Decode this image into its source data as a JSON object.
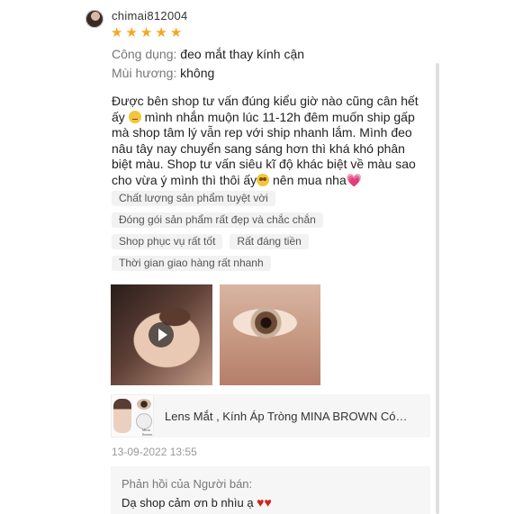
{
  "review": {
    "username": "chimai812004",
    "rating": 5,
    "attributes": [
      {
        "label": "Công dụng",
        "value": "đeo mắt thay kính cận"
      },
      {
        "label": "Mùi hương",
        "value": "không"
      }
    ],
    "text_part1": "Được bên shop tư vấn đúng kiểu giờ nào cũng cân hết ấy ",
    "text_part2": " mình nhắn muộn lúc 11-12h đêm muốn ship gấp mà shop tâm lý vẫn rep với ship nhanh lắm. Mình đeo nâu tây nay chuyển sang sáng hơn thì khá khó phân biệt màu. Shop tư vấn siêu kĩ độ khác biệt về màu sao cho vừa ý mình thì thôi ấy",
    "text_part3": " nên mua nha",
    "tags": [
      [
        "Chất lượng sản phẩm tuyệt vời"
      ],
      [
        "Đóng gói sản phẩm rất đẹp và chắc chắn"
      ],
      [
        "Shop phục vụ rất tốt",
        "Rất đáng tiền"
      ],
      [
        "Thời gian giao hàng rất nhanh"
      ]
    ],
    "timestamp": "13-09-2022 13:55"
  },
  "product": {
    "name": "Lens Mắt , Kính Áp Tròng MINA BROWN Có…",
    "thumb_caption": "Mina Brown"
  },
  "seller_reply": {
    "title": "Phản hồi của Người bán:",
    "message": "Dạ shop cảm ơn b nhìu ạ "
  },
  "icons": {
    "star": "★",
    "heart_pink": "💗",
    "heart_red": "♥"
  },
  "colors": {
    "star": "#f5a623",
    "heart_red": "#d0231c",
    "heart_pink": "#e35fa7"
  }
}
